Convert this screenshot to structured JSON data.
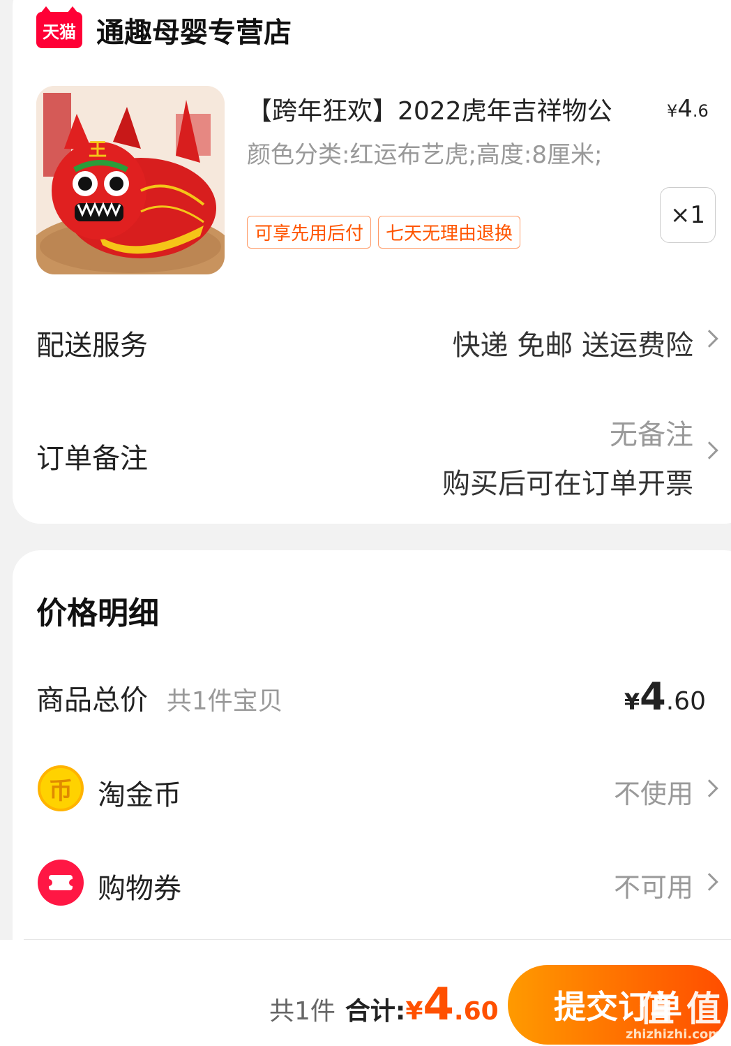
{
  "shop": {
    "logo_text": "天猫",
    "name": "通趣母婴专营店"
  },
  "product": {
    "title": "【跨年狂欢】2022虎年吉祥物公",
    "price_symbol": "¥",
    "price_int": "4",
    "price_dec": ".6",
    "spec": "颜色分类:红运布艺虎;高度:8厘米;",
    "tags": [
      "可享先用后付",
      "七天无理由退换"
    ],
    "quantity": "×1"
  },
  "delivery": {
    "label": "配送服务",
    "value": "快递 免邮 送运费险"
  },
  "remark": {
    "label": "订单备注",
    "value": "无备注",
    "invoice": "购买后可在订单开票"
  },
  "price_detail": {
    "title": "价格明细",
    "subtotal_label": "商品总价",
    "subtotal_count": "共1件宝贝",
    "subtotal_symbol": "¥",
    "subtotal_int": "4",
    "subtotal_dec": ".60",
    "coins_label": "淘金币",
    "coins_value": "不使用",
    "coupon_label": "购物券",
    "coupon_value": "不可用"
  },
  "bottom": {
    "count": "共1件",
    "total_label": "合计:",
    "symbol": "¥",
    "total_int": "4",
    "total_dec": ".60",
    "submit": "提交订单"
  },
  "watermark": {
    "main": "值 值",
    "sub": "zhizhizhi.com"
  },
  "colors": {
    "accent": "#ff5000",
    "tmall_red": "#ff0036",
    "tag_orange": "#ff5500"
  }
}
